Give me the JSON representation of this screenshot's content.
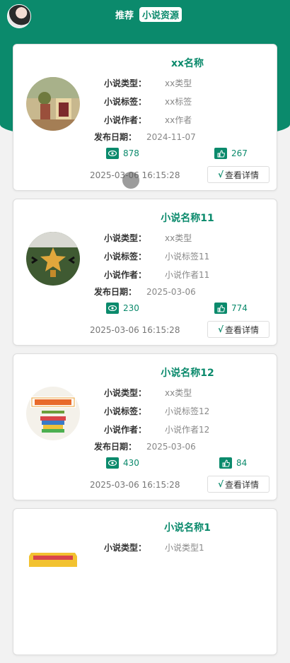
{
  "nav": {
    "tabs": [
      {
        "label": "推荐"
      },
      {
        "label": "小说资源"
      }
    ]
  },
  "labels": {
    "type": "小说类型：",
    "tag": "小说标签：",
    "author": "小说作者：",
    "date": "发布日期：",
    "detail": "查看详情",
    "check": "√"
  },
  "cards": [
    {
      "title": "xx名称",
      "type": "xx类型",
      "tag": "xx标签",
      "author": "xx作者",
      "date": "2024-11-07",
      "views": "878",
      "likes": "267",
      "time": "2025-03-06 16:15:28"
    },
    {
      "title": "小说名称11",
      "type": "xx类型",
      "tag": "小说标签11",
      "author": "小说作者11",
      "date": "2025-03-06",
      "views": "230",
      "likes": "774",
      "time": "2025-03-06 16:15:28"
    },
    {
      "title": "小说名称12",
      "type": "xx类型",
      "tag": "小说标签12",
      "author": "小说作者12",
      "date": "2025-03-06",
      "views": "430",
      "likes": "84",
      "time": "2025-03-06 16:15:28"
    },
    {
      "title": "小说名称1",
      "type": "小说类型1"
    }
  ],
  "icons": {
    "views": "eye-icon",
    "likes": "thumbs-up-icon"
  },
  "colors": {
    "accent": "#0b8a6c"
  }
}
